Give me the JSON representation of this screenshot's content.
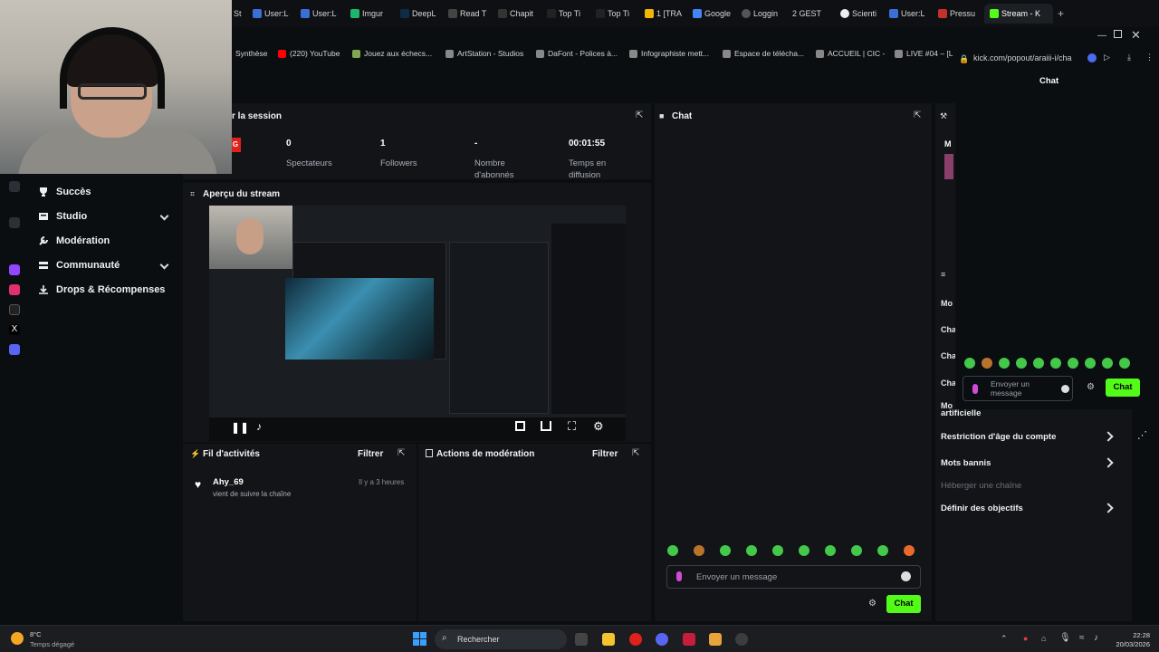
{
  "browser": {
    "tabs": [
      {
        "label": "St"
      },
      {
        "label": "User:L"
      },
      {
        "label": "User:L"
      },
      {
        "label": "Imgur"
      },
      {
        "label": "DeepL"
      },
      {
        "label": "Read T"
      },
      {
        "label": "Chapit"
      },
      {
        "label": "Top Ti"
      },
      {
        "label": "Top Ti"
      },
      {
        "label": "1 [TRA"
      },
      {
        "label": "Google"
      },
      {
        "label": "Loggin"
      },
      {
        "label": "2 GEST"
      },
      {
        "label": "Scienti"
      },
      {
        "label": "User:L"
      },
      {
        "label": "Pressu"
      },
      {
        "label": "Stream - K"
      }
    ],
    "new_tab": "+",
    "bookmarks": [
      {
        "label": "Synthèse"
      },
      {
        "label": "(220) YouTube"
      },
      {
        "label": "Jouez aux échecs..."
      },
      {
        "label": "ArtStation - Studios"
      },
      {
        "label": "DaFont - Polices à..."
      },
      {
        "label": "Infographiste mett..."
      },
      {
        "label": "Espace de télécha..."
      },
      {
        "label": "ACCUEIL | CIC -"
      },
      {
        "label": "LIVE #04 – [L"
      }
    ],
    "popup_url": "kick.com/popout/araiii-i/cha",
    "popup_title": "Chat",
    "colors": {
      "kick_green": "#53fc18",
      "bg": "#0b0e11",
      "panel": "#121418"
    }
  },
  "dashboard": {
    "session_title": "r la session",
    "live_badge": "G",
    "stats": [
      {
        "value": "0",
        "label": "Spectateurs"
      },
      {
        "value": "1",
        "label": "Followers"
      },
      {
        "value": "-",
        "label": "Nombre d'abonnés"
      },
      {
        "value": "00:01:55",
        "label": "Temps en diffusion"
      }
    ],
    "nav": [
      {
        "label": "Succès",
        "icon": "trophy-icon"
      },
      {
        "label": "Studio",
        "icon": "studio-icon",
        "expand": true
      },
      {
        "label": "Modération",
        "icon": "wrench-icon"
      },
      {
        "label": "Communauté",
        "icon": "community-icon",
        "expand": true
      },
      {
        "label": "Drops & Récompenses",
        "icon": "drops-icon"
      }
    ],
    "preview": {
      "title": "Aperçu du stream"
    },
    "activity": {
      "title": "Fil d'activités",
      "filter": "Filtrer",
      "items": [
        {
          "user": "Ahy_69",
          "text": "vient de suivre la chaîne",
          "time": "Il y a 3 heures"
        }
      ]
    },
    "moderation": {
      "title": "Actions de modération",
      "filter": "Filtrer"
    },
    "chat": {
      "title": "Chat",
      "placeholder": "Envoyer un message",
      "send": "Chat"
    },
    "right_panel": {
      "items": [
        {
          "label": "artificielle",
          "chevron": false
        },
        {
          "label": "Restriction d'âge du compte",
          "chevron": true
        },
        {
          "label": "Mots bannis",
          "chevron": true
        },
        {
          "label": "Héberger une chaîne",
          "chevron": false,
          "muted": true
        },
        {
          "label": "Définir des objectifs",
          "chevron": true
        }
      ],
      "partial": [
        "Mo",
        "Cha",
        "Cha",
        "Cha",
        "Mo"
      ]
    },
    "popup_chat": {
      "placeholder": "Envoyer un message",
      "send": "Chat"
    }
  },
  "taskbar": {
    "weather_temp": "8°C",
    "weather_text": "Temps dégagé",
    "search": "Rechercher",
    "time": "22:28",
    "date": "20/03/2026"
  }
}
